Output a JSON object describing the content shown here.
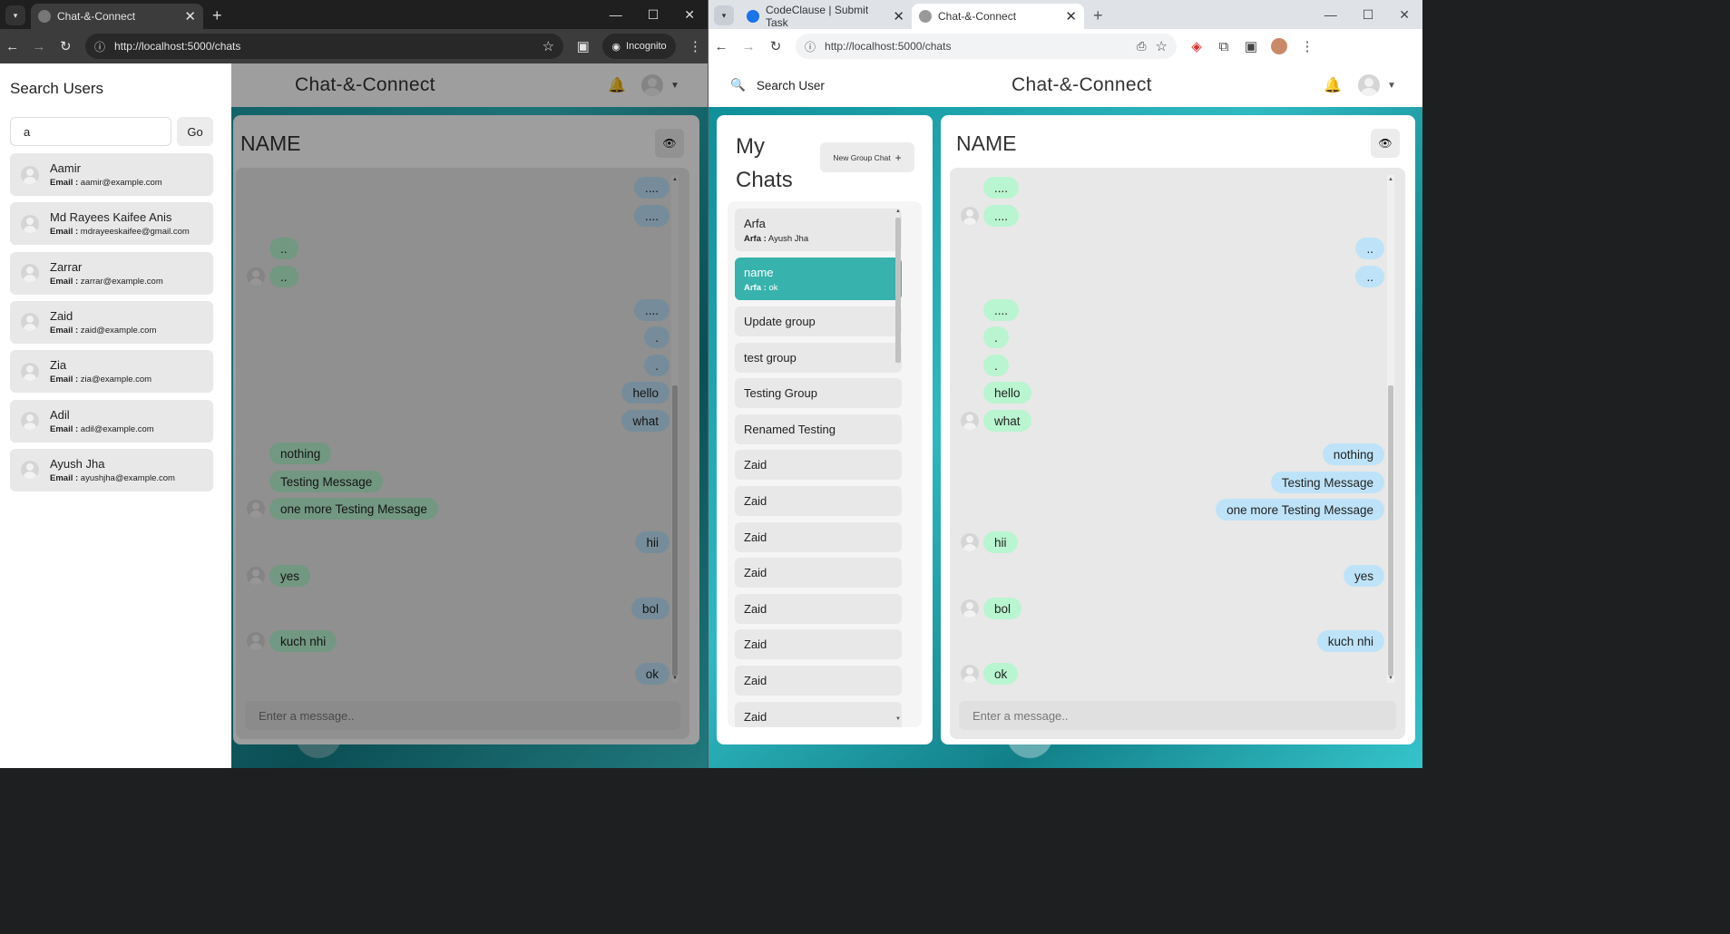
{
  "left_window": {
    "tab_title": "Chat-&-Connect",
    "url": "http://localhost:5000/chats",
    "incognito_label": "Incognito",
    "app": {
      "brand": "Chat-&-Connect",
      "chat_title": "NAME",
      "message_placeholder": "Enter a message..",
      "messages": [
        "....",
        "....",
        "..",
        "..",
        "....",
        ".",
        ".",
        "hello",
        "what",
        "nothing",
        "Testing Message",
        "one more Testing Message",
        "hii",
        "yes",
        "bol",
        "kuch nhi",
        "ok"
      ]
    },
    "drawer": {
      "title": "Search Users",
      "search_value": "a",
      "go_label": "Go",
      "email_label": "Email :",
      "users": [
        {
          "name": "Aamir",
          "email": "aamir@example.com"
        },
        {
          "name": "Md Rayees Kaifee Anis",
          "email": "mdrayeeskaifee@gmail.com"
        },
        {
          "name": "Zarrar",
          "email": "zarrar@example.com"
        },
        {
          "name": "Zaid",
          "email": "zaid@example.com"
        },
        {
          "name": "Zia",
          "email": "zia@example.com"
        },
        {
          "name": "Adil",
          "email": "adil@example.com"
        },
        {
          "name": "Ayush Jha",
          "email": "ayushjha@example.com"
        }
      ]
    }
  },
  "right_window": {
    "tabs": [
      "CodeClause | Submit Task",
      "Chat-&-Connect"
    ],
    "url": "http://localhost:5000/chats",
    "app": {
      "search_label": "Search User",
      "brand": "Chat-&-Connect",
      "my_chats_title": "My Chats",
      "new_group_label": "New Group Chat",
      "chats": [
        {
          "name": "Arfa",
          "sender": "Arfa :",
          "latest": "Ayush Jha"
        },
        {
          "name": "name",
          "sender": "Arfa :",
          "latest": "ok"
        },
        {
          "name": "Update group"
        },
        {
          "name": "test group"
        },
        {
          "name": "Testing Group"
        },
        {
          "name": "Renamed Testing"
        },
        {
          "name": "Zaid"
        },
        {
          "name": "Zaid"
        },
        {
          "name": "Zaid"
        },
        {
          "name": "Zaid"
        },
        {
          "name": "Zaid"
        },
        {
          "name": "Zaid"
        },
        {
          "name": "Zaid"
        },
        {
          "name": "Zaid"
        }
      ],
      "chat_title": "NAME",
      "message_placeholder": "Enter a message..",
      "messages": [
        "....",
        "....",
        "..",
        "..",
        "....",
        ".",
        ".",
        "hello",
        "what",
        "nothing",
        "Testing Message",
        "one more Testing Message",
        "hii",
        "yes",
        "bol",
        "kuch nhi",
        "ok"
      ]
    }
  },
  "colors": {
    "accent": "#38b2ac",
    "mine": "#bee3f8",
    "theirs": "#b9f5d0"
  }
}
